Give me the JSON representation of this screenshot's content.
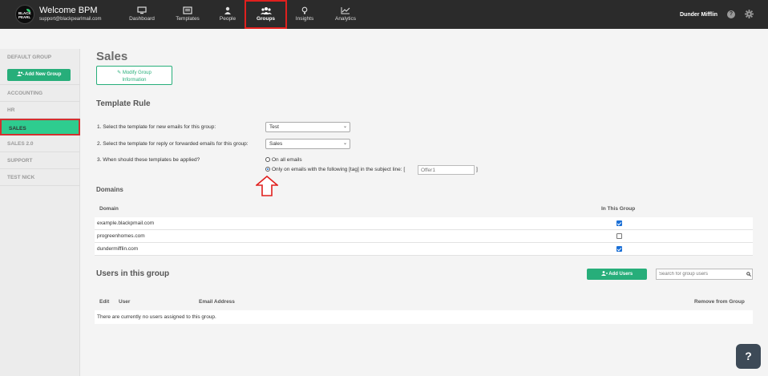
{
  "header": {
    "logo_text": "BLACK PEARL",
    "welcome": "Welcome BPM",
    "email": "support@blackpearlmail.com",
    "org_name": "Dunder Mifflin",
    "help_icon": "question-circle-icon",
    "settings_icon": "gear-icon",
    "nav": [
      {
        "label": "Dashboard",
        "icon": "monitor-icon",
        "active": false
      },
      {
        "label": "Templates",
        "icon": "template-icon",
        "active": false
      },
      {
        "label": "People",
        "icon": "person-icon",
        "active": false
      },
      {
        "label": "Groups",
        "icon": "users-icon",
        "active": true
      },
      {
        "label": "Insights",
        "icon": "lightbulb-icon",
        "active": false
      },
      {
        "label": "Analytics",
        "icon": "line-chart-icon",
        "active": false
      }
    ]
  },
  "sidebar": {
    "add_group_label": "Add New Group",
    "items": [
      {
        "label": "DEFAULT GROUP",
        "active": false
      },
      {
        "label": "ACCOUNTING",
        "active": false
      },
      {
        "label": "HR",
        "active": false
      },
      {
        "label": "SALES",
        "active": true
      },
      {
        "label": "SALES 2.0",
        "active": false
      },
      {
        "label": "SUPPORT",
        "active": false
      },
      {
        "label": "TEST NICK",
        "active": false
      }
    ]
  },
  "main": {
    "title": "Sales",
    "modify_label_1": "Modify Group",
    "modify_label_2": "Information",
    "template_rule": {
      "heading": "Template Rule",
      "q1": "1. Select the template for new emails for this group:",
      "q1_value": "Test",
      "q2": "2. Select the template for reply or forwarded emails for this group:",
      "q2_value": "Sales",
      "q3": "3. When should these templates be applied?",
      "opt_all": "On all emails",
      "opt_tag": "Only on emails with the following [tag] in the subject line: [",
      "tag_close": "]",
      "tag_placeholder": "Offer1",
      "selected_option": "tag"
    },
    "domains": {
      "heading": "Domains",
      "col_domain": "Domain",
      "col_in_group": "In This Group",
      "rows": [
        {
          "domain": "example.blackpmail.com",
          "in_group": true
        },
        {
          "domain": "progreenhomes.com",
          "in_group": false
        },
        {
          "domain": "dundermifflin.com",
          "in_group": true
        }
      ]
    },
    "users": {
      "heading": "Users in this group",
      "add_label": "Add Users",
      "search_placeholder": "Search for group users",
      "col_edit": "Edit",
      "col_user": "User",
      "col_email": "Email Address",
      "col_remove": "Remove from Group",
      "empty": "There are currently no users assigned to this group."
    }
  },
  "fab": {
    "label": "?"
  },
  "colors": {
    "accent": "#27ae7a",
    "highlight": "#d32f2f",
    "topbar": "#2b2b2b"
  }
}
